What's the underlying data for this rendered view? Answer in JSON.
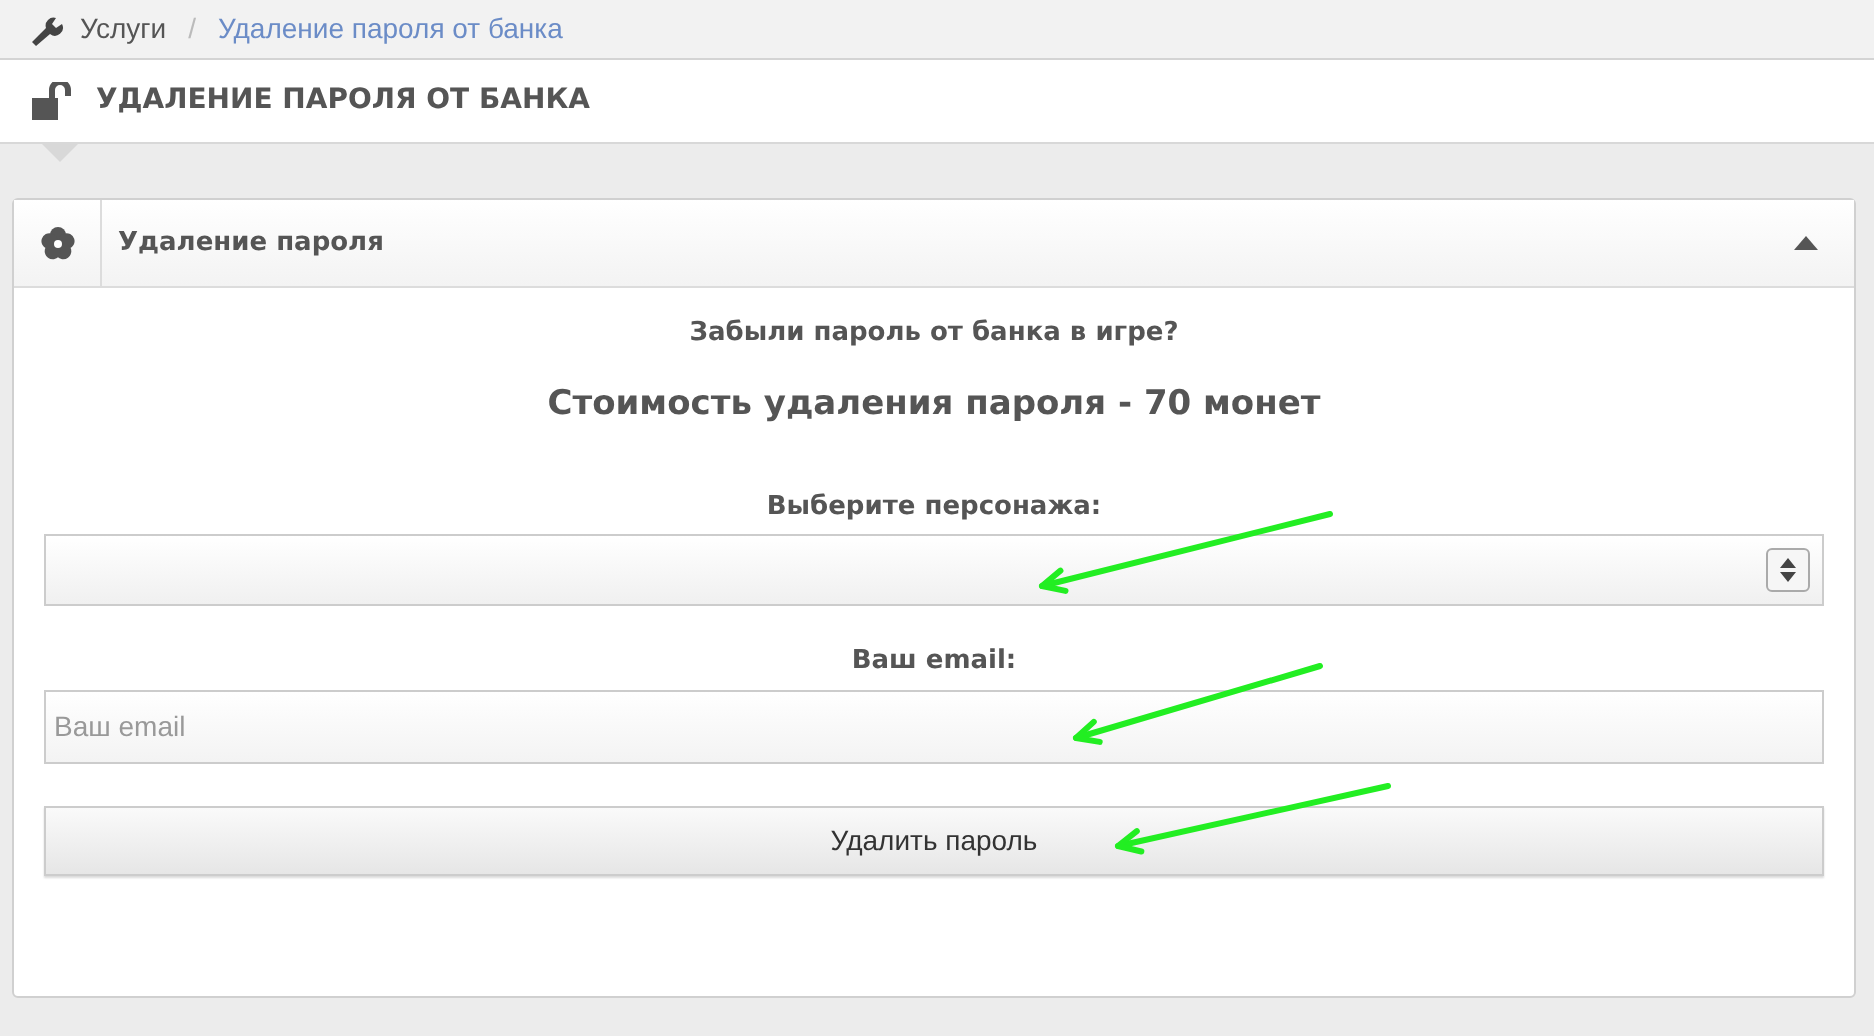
{
  "breadcrumb": {
    "items": [
      {
        "label": "Услуги",
        "selected": false
      },
      {
        "label": "Удаление пароля от банка",
        "selected": true
      }
    ],
    "separator": "/"
  },
  "page_title": "УДАЛЕНИЕ ПАРОЛЯ ОТ БАНКА",
  "panel": {
    "title": "Удаление пароля",
    "expanded": true,
    "question": "Забыли пароль от банка в игре?",
    "price": "Стоимость удаления пароля - 70 монет",
    "character_label": "Выберите персонажа:",
    "email_label": "Ваш email:",
    "email_field": {
      "placeholder": "Ваш email"
    },
    "submit_button": "Удалить пароль"
  }
}
